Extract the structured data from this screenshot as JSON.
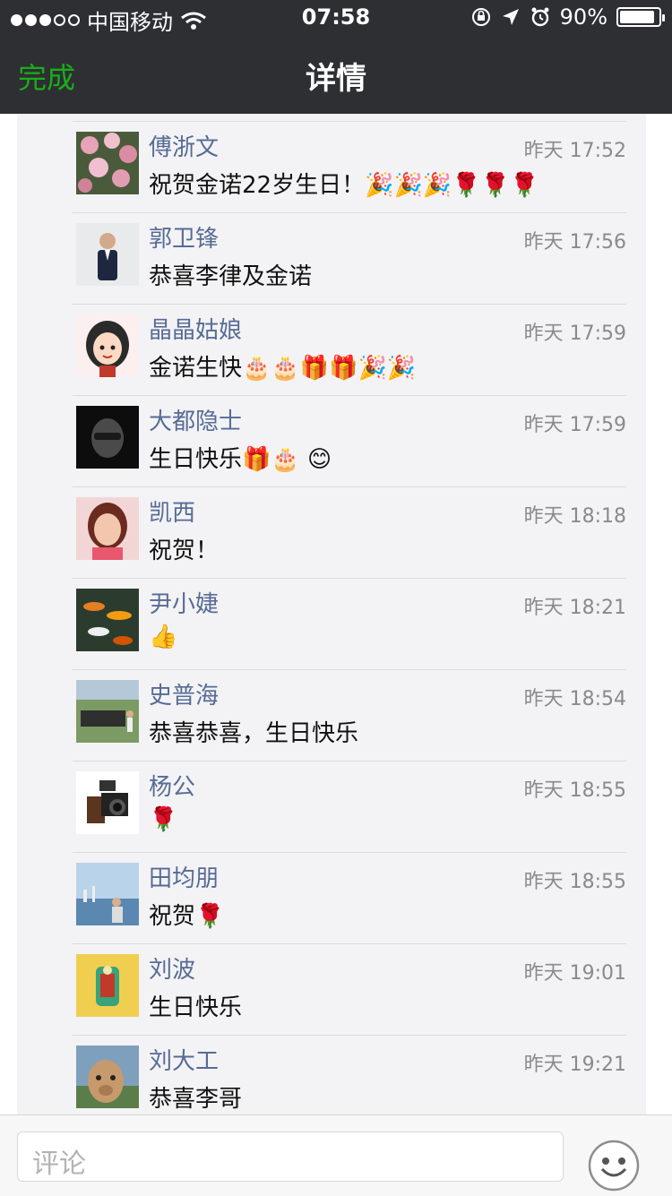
{
  "status": {
    "carrier": "中国移动",
    "time": "07:58",
    "battery": "90%",
    "battery_level": 0.9
  },
  "nav": {
    "done_label": "完成",
    "title": "详情"
  },
  "comments": [
    {
      "name": "傅浙文",
      "time": "昨天 17:52",
      "text": "祝贺金诺22岁生日！🎉🎉🎉🌹🌹🌹",
      "avatar": "flowers"
    },
    {
      "name": "郭卫锋",
      "time": "昨天 17:56",
      "text": "恭喜李律及金诺",
      "avatar": "suit"
    },
    {
      "name": "晶晶姑娘",
      "time": "昨天 17:59",
      "text": "金诺生快🎂🎂🎁🎁🎉🎉",
      "avatar": "cartoon"
    },
    {
      "name": "大都隐士",
      "time": "昨天 17:59",
      "text": "生日快乐🎁🎂 😊",
      "avatar": "dark"
    },
    {
      "name": "凯西",
      "time": "昨天 18:18",
      "text": "祝贺！",
      "avatar": "woman"
    },
    {
      "name": "尹小婕",
      "time": "昨天 18:21",
      "text": "👍",
      "avatar": "koi"
    },
    {
      "name": "史普海",
      "time": "昨天 18:54",
      "text": "恭喜恭喜，生日快乐",
      "avatar": "outdoor"
    },
    {
      "name": "杨公",
      "time": "昨天 18:55",
      "text": "🌹",
      "avatar": "camera"
    },
    {
      "name": "田均朋",
      "time": "昨天 18:55",
      "text": "祝贺🌹",
      "avatar": "harbor"
    },
    {
      "name": "刘波",
      "time": "昨天 19:01",
      "text": "生日快乐",
      "avatar": "thangka"
    },
    {
      "name": "刘大工",
      "time": "昨天 19:21",
      "text": "恭喜李哥",
      "avatar": "alpaca"
    }
  ],
  "input": {
    "placeholder": "评论"
  },
  "colors": {
    "header_bg": "#2e2f33",
    "accent_green": "#1aad19",
    "name_blue": "#576b95",
    "panel_bg": "#f3f3f5"
  }
}
